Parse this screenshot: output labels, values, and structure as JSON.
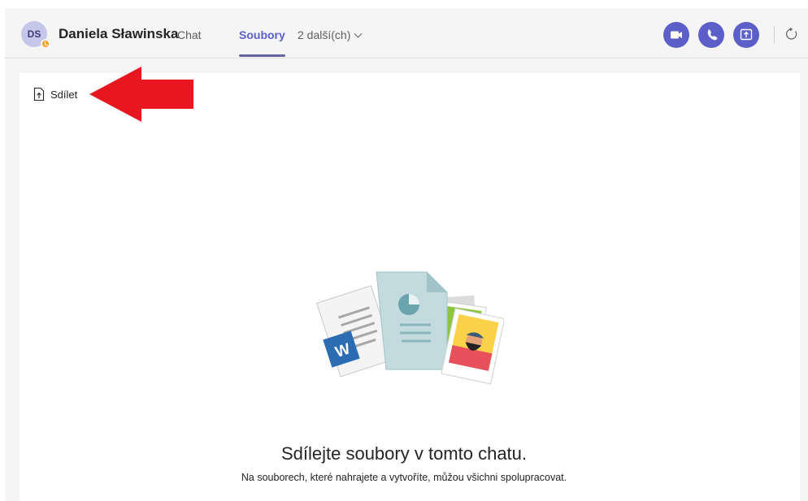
{
  "header": {
    "avatar_initials": "DS",
    "contact_name": "Daniela Sławinska",
    "tabs": [
      {
        "label": "Chat",
        "active": false
      },
      {
        "label": "Soubory",
        "active": true
      }
    ],
    "more_tabs_label": "2 další(ch)",
    "buttons": {
      "video_call": "video-camera-icon",
      "audio_call": "phone-icon",
      "share_screen": "share-screen-icon",
      "refresh": "refresh-icon"
    }
  },
  "toolbar": {
    "share_label": "Sdílet"
  },
  "empty_state": {
    "title": "Sdílejte soubory v tomto chatu.",
    "subtitle": "Na souborech, které nahrajete a vytvoříte, můžou všichni spolupracovat."
  },
  "colors": {
    "accent": "#5b5fc7",
    "presence_away": "#f8a21b",
    "annotation_arrow": "#e8171f"
  }
}
